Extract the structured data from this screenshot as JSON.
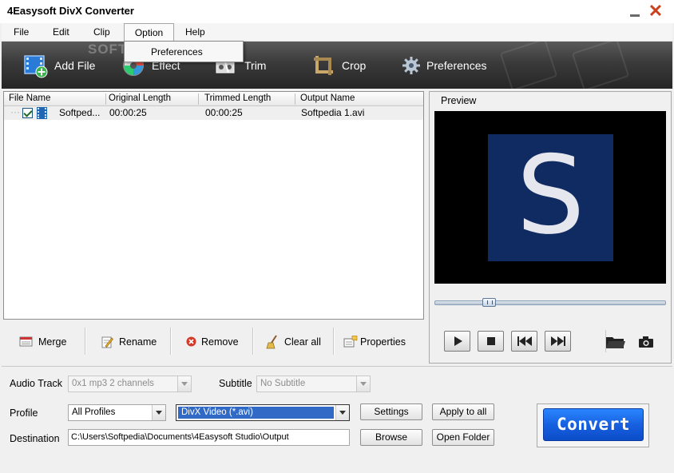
{
  "window": {
    "title": "4Easysoft DivX Converter"
  },
  "menu": {
    "items": [
      "File",
      "Edit",
      "Clip",
      "Option",
      "Help"
    ],
    "open": "Option"
  },
  "option_menu": {
    "items": [
      "Preferences"
    ]
  },
  "toolbar": {
    "add_file": "Add File",
    "effect": "Effect",
    "trim": "Trim",
    "crop": "Crop",
    "preferences": "Preferences"
  },
  "watermark": "SOFTPEDIA",
  "file_list": {
    "headers": [
      "File Name",
      "Original Length",
      "Trimmed Length",
      "Output Name"
    ],
    "rows": [
      {
        "checked": true,
        "name": "Softped...",
        "original": "00:00:25",
        "trimmed": "00:00:25",
        "output": "Softpedia 1.avi"
      }
    ]
  },
  "list_actions": {
    "merge": "Merge",
    "rename": "Rename",
    "remove": "Remove",
    "clear_all": "Clear all",
    "properties": "Properties"
  },
  "preview": {
    "label": "Preview",
    "logo_letter": "S",
    "seek_fraction": 0.22
  },
  "settings": {
    "audio_track_label": "Audio Track",
    "audio_track_value": "0x1 mp3 2 channels",
    "subtitle_label": "Subtitle",
    "subtitle_value": "No Subtitle",
    "profile_label": "Profile",
    "profile_category": "All Profiles",
    "profile_format": "DivX Video (*.avi)",
    "settings_button": "Settings",
    "apply_to_all_button": "Apply to all",
    "destination_label": "Destination",
    "destination_value": "C:\\Users\\Softpedia\\Documents\\4Easysoft Studio\\Output",
    "browse_button": "Browse",
    "open_folder_button": "Open Folder",
    "convert_button": "Convert"
  },
  "colors": {
    "toolbar_bg": "#333333",
    "convert_blue": "#1760e0",
    "preview_logo_bg": "#0f2b62",
    "selection_blue": "#3169c6",
    "close_red": "#c9411e"
  }
}
